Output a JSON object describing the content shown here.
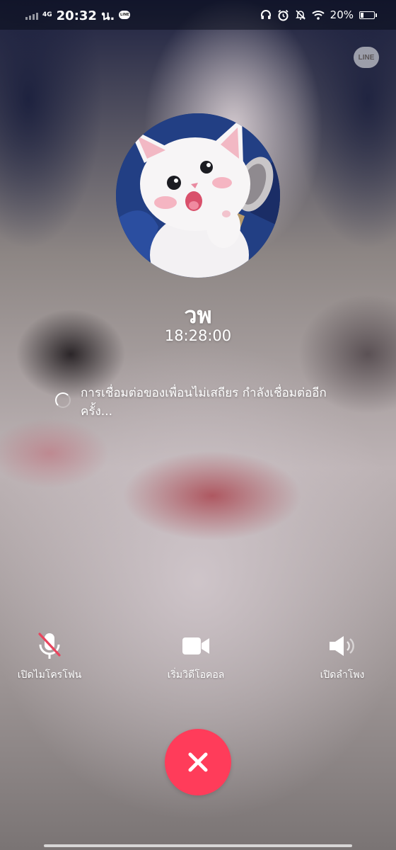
{
  "status_bar": {
    "network": "4G",
    "time": "20:32 น.",
    "notification_app": "LINE",
    "battery_percent": "20%",
    "battery_level": 0.2,
    "icons": [
      "headphones-icon",
      "alarm-icon",
      "mute-icon",
      "wifi-icon",
      "battery-icon"
    ]
  },
  "app_badge": "LINE",
  "call": {
    "caller_name": "วพ",
    "duration": "18:28:00",
    "status_message": "การเชื่อมต่อของเพื่อนไม่เสถียร กำลังเชื่อมต่ออีกครั้ง..."
  },
  "controls": [
    {
      "label": "เปิดไมโครโฟน",
      "icon": "mic-off-icon"
    },
    {
      "label": "เริ่มวิดีโอคอล",
      "icon": "video-camera-icon"
    },
    {
      "label": "เปิดลำโพง",
      "icon": "speaker-icon"
    }
  ],
  "end_call": {
    "icon": "close-icon"
  },
  "colors": {
    "end_call": "#ff3c5a",
    "text": "#ffffff"
  }
}
